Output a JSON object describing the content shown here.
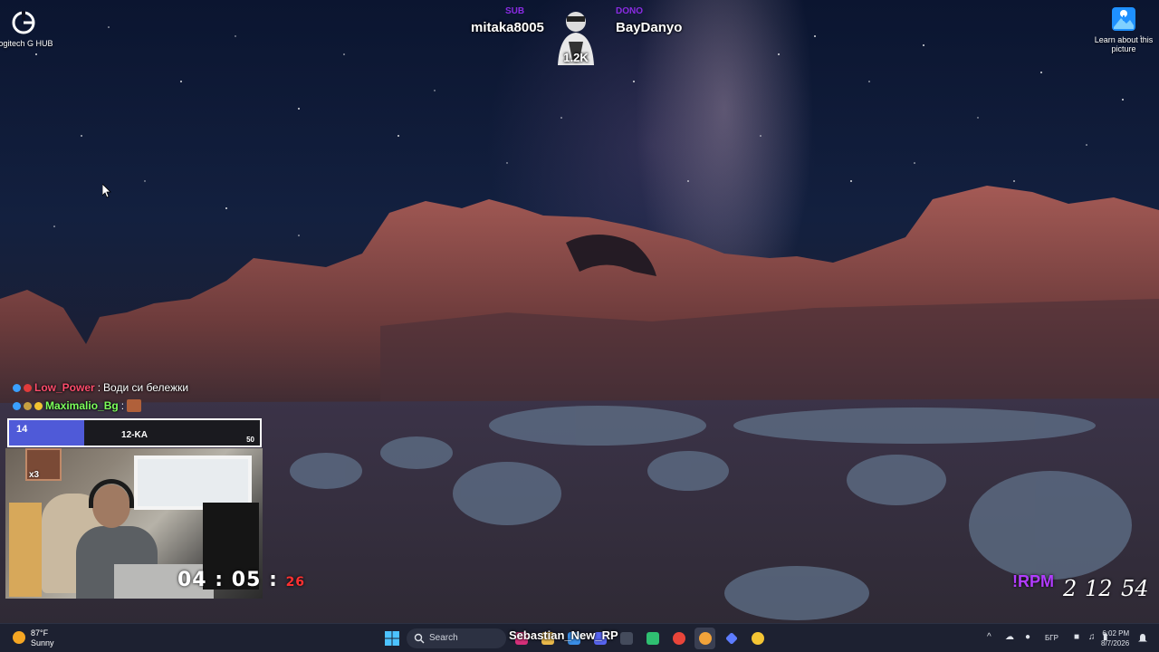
{
  "desktop": {
    "icons": [
      {
        "label": "Logitech G HUB"
      },
      {
        "label": "Learn about this picture"
      }
    ]
  },
  "stream_overlay": {
    "left_tag": "SUB",
    "left_name": "mitaka8005",
    "right_tag": "DONO",
    "right_name": "BayDanyo",
    "count": "1.2K",
    "chat": [
      {
        "user": "Low_Power",
        "message": "Води си бележки",
        "user_color": "#ff4d6d"
      },
      {
        "user": "Maximalio_Bg",
        "message": "",
        "user_color": "#7dff5a"
      }
    ],
    "goal": {
      "start": "14",
      "label": "12-KA",
      "end": "50",
      "progress": 0.3
    },
    "webcam_badge": "x3",
    "timer": {
      "hours": "04",
      "minutes": "05",
      "seconds": "26"
    },
    "rpm": {
      "label": "!RPM",
      "values": [
        "2",
        "12",
        "54"
      ]
    }
  },
  "taskbar": {
    "weather": {
      "temp": "87°F",
      "condition": "Sunny"
    },
    "search_placeholder": "Search",
    "stream_title": "Sebastian_New_RP",
    "language": "БГР",
    "time": "6:02 PM",
    "date": "8/7/2026"
  },
  "colors": {
    "taskbar_bg": "#1d2131",
    "goal_fill": "#4f5ad8",
    "rpm_purple": "#b23cff",
    "timer_seconds": "#ff3030"
  }
}
